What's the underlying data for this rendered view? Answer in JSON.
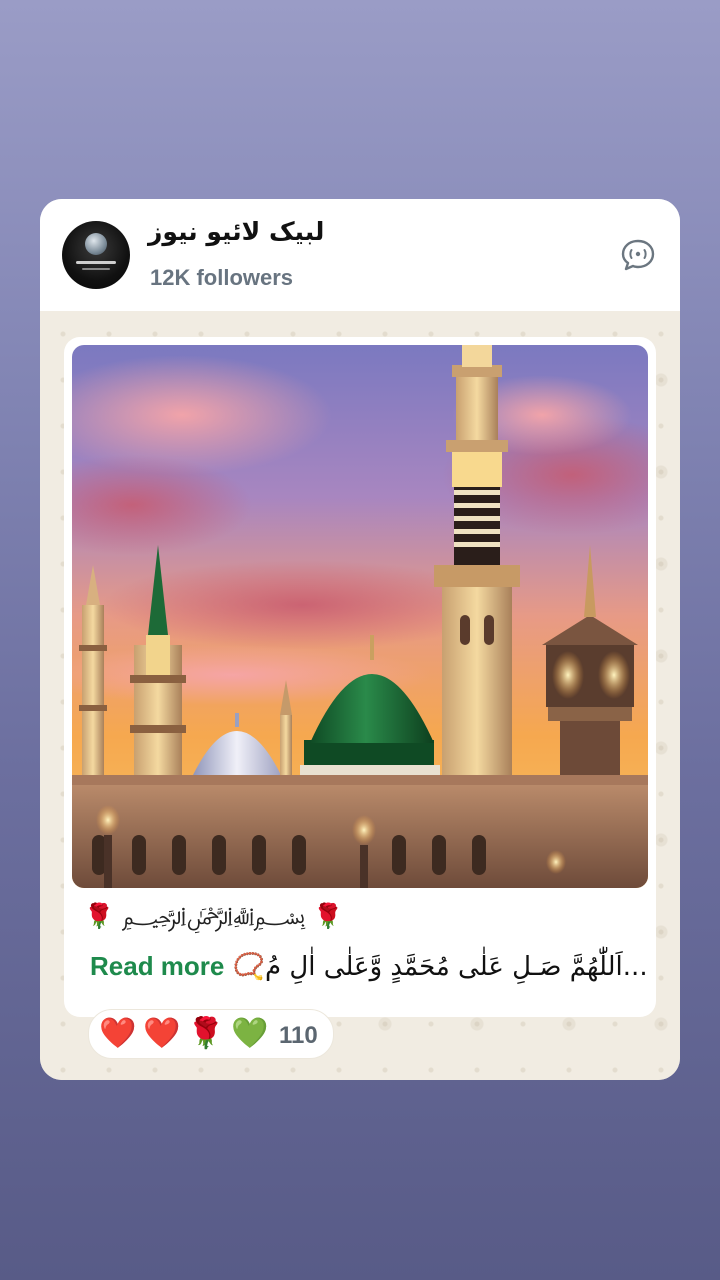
{
  "channel": {
    "name": "لبیک لائیو نیوز",
    "followers": "12K followers",
    "avatar_text": "لبیک لائیو نیوز"
  },
  "post": {
    "bismillah_line": "🌹 ﷽ 🌹",
    "caption": "📿اَللّٰهُمَّ صَـلِ عَلٰی مُحَمَّدٍ وَّعَلٰی اٰلِ مُ...",
    "read_more": "Read more"
  },
  "reactions": {
    "emojis": [
      "❤️",
      "❤️",
      "🌹",
      "💚"
    ],
    "count": "110"
  },
  "icons": {
    "chat": "channel-chat-icon"
  },
  "colors": {
    "accent_green": "#1e8a4c",
    "dome_green": "#1a6a35"
  }
}
